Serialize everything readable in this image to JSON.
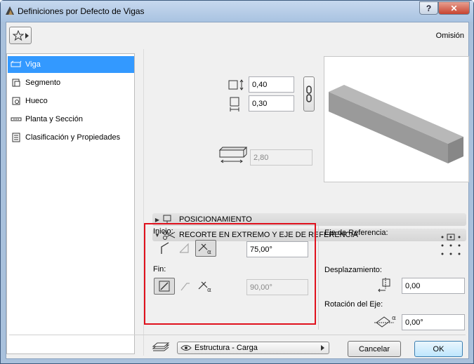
{
  "window": {
    "title": "Definiciones por Defecto de Vigas",
    "help_label": "?",
    "close_label": "✕"
  },
  "header": {
    "favorites_icon": "star-icon",
    "preset_label": "Omisión"
  },
  "sidebar": {
    "items": [
      {
        "label": "Viga",
        "icon": "beam-icon",
        "active": true
      },
      {
        "label": "Segmento",
        "icon": "segment-icon",
        "active": false
      },
      {
        "label": "Hueco",
        "icon": "hole-icon",
        "active": false
      },
      {
        "label": "Planta y Sección",
        "icon": "floorplan-icon",
        "active": false
      },
      {
        "label": "Clasificación y Propiedades",
        "icon": "properties-icon",
        "active": false
      }
    ]
  },
  "geometry": {
    "width_value": "0,40",
    "height_value": "0,30",
    "length_value": "2,80"
  },
  "sections": {
    "positioning": "POSICIONAMIENTO",
    "end_cut": "RECORTE EN EXTREMO Y EJE DE REFERENCIA"
  },
  "end_cut": {
    "start_label": "Inicio:",
    "start_angle": "75,00°",
    "end_label": "Fin:",
    "end_angle": "90,00°"
  },
  "reference_axis": {
    "label": "Eje de Referencia:",
    "offset_label": "Desplazamiento:",
    "offset_value": "0,00",
    "rotation_label": "Rotación del Eje:",
    "rotation_value": "0,00°"
  },
  "footer": {
    "layer_value": "Estructura - Carga",
    "cancel_label": "Cancelar",
    "ok_label": "OK"
  },
  "colors": {
    "selection": "#3399ff",
    "highlight_border": "#e0101c"
  }
}
